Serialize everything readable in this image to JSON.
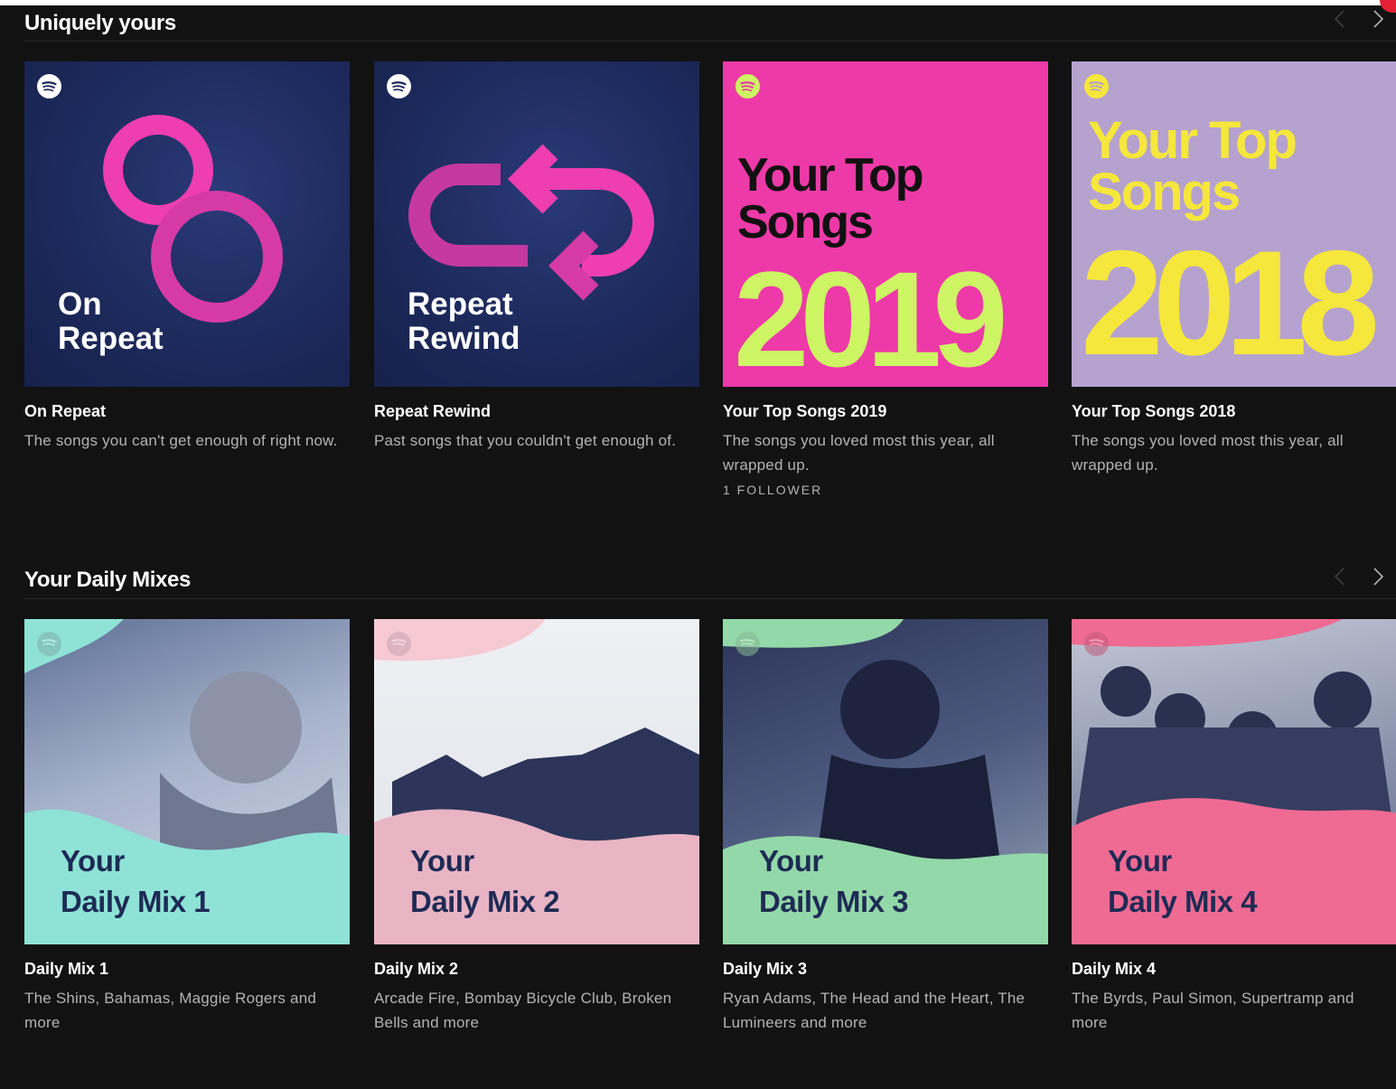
{
  "colors": {
    "background": "#121212",
    "repeat_cover_bg": "#1d2a5c",
    "repeat_accent": "#ee3eb0",
    "top2019_bg": "#ee3aa8",
    "top2019_year": "#cdf564",
    "top2018_bg": "#b6a2cf",
    "top2018_text": "#f5e73b",
    "mix_navy": "#1e2b55"
  },
  "sections": [
    {
      "title": "Uniquely yours",
      "cards": [
        {
          "cover_lines": [
            "On",
            "Repeat"
          ],
          "title": "On Repeat",
          "description": "The songs you can't get enough of right now.",
          "meta": ""
        },
        {
          "cover_lines": [
            "Repeat",
            "Rewind"
          ],
          "title": "Repeat Rewind",
          "description": "Past songs that you couldn't get enough of.",
          "meta": ""
        },
        {
          "cover_lines": [
            "Your Top",
            "Songs"
          ],
          "cover_year": "2019",
          "title": "Your Top Songs 2019",
          "description": "The songs you loved most this year, all wrapped up.",
          "meta": "1 FOLLOWER"
        },
        {
          "cover_lines": [
            "Your Top",
            "Songs"
          ],
          "cover_year": "2018",
          "title": "Your Top Songs 2018",
          "description": "The songs you loved most this year, all wrapped up.",
          "meta": ""
        }
      ]
    },
    {
      "title": "Your Daily Mixes",
      "cards": [
        {
          "cover_lines": [
            "Your",
            "Daily Mix 1"
          ],
          "title": "Daily Mix 1",
          "description": "The Shins, Bahamas, Maggie Rogers and more",
          "theme": "#8fe3d6"
        },
        {
          "cover_lines": [
            "Your",
            "Daily Mix 2"
          ],
          "title": "Daily Mix 2",
          "description": "Arcade Fire, Bombay Bicycle Club, Broken Bells and more",
          "theme": "#e9b4c4"
        },
        {
          "cover_lines": [
            "Your",
            "Daily Mix 3"
          ],
          "title": "Daily Mix 3",
          "description": "Ryan Adams, The Head and the Heart, The Lumineers and more",
          "theme": "#93d8a8"
        },
        {
          "cover_lines": [
            "Your",
            "Daily Mix 4"
          ],
          "title": "Daily Mix 4",
          "description": "The Byrds, Paul Simon, Supertramp and more",
          "theme": "#ef6b93"
        }
      ]
    }
  ],
  "icons": {
    "prev": "chevron-left-icon",
    "next": "chevron-right-icon",
    "logo": "spotify-logo-icon"
  }
}
